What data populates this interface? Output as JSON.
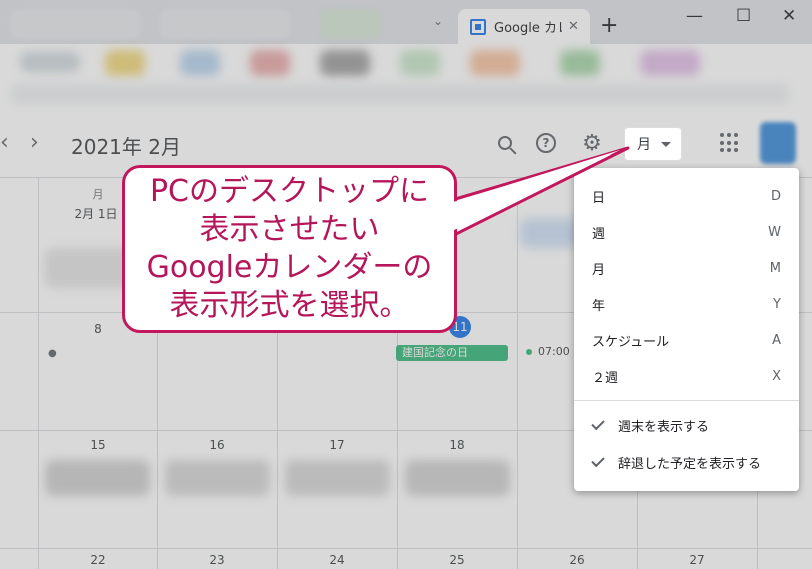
{
  "browser": {
    "tab_title": "Google カレンダー",
    "close_glyph": "✕",
    "new_tab_glyph": "+",
    "tab_dropdown_glyph": "⌄",
    "window_controls": {
      "minimize": "—",
      "maximize": "☐",
      "close": "✕"
    }
  },
  "header": {
    "prev_glyph": "‹",
    "next_glyph": "›",
    "month_title": "2021年 2月",
    "view_selector": "月",
    "icons": [
      "search-icon",
      "help-icon",
      "gear-icon",
      "apps-icon"
    ]
  },
  "grid": {
    "first_col_dow": "月",
    "first_col_date": "2月 1日",
    "week2": [
      "8",
      "11"
    ],
    "week3": [
      "15",
      "16",
      "17",
      "18"
    ],
    "week4": [
      "22",
      "23",
      "24",
      "25",
      "26",
      "27"
    ],
    "holiday_label": "建国記念の日",
    "event_time": "07:00"
  },
  "menu": {
    "items": [
      {
        "label": "日",
        "key": "D"
      },
      {
        "label": "週",
        "key": "W"
      },
      {
        "label": "月",
        "key": "M"
      },
      {
        "label": "年",
        "key": "Y"
      },
      {
        "label": "スケジュール",
        "key": "A"
      },
      {
        "label": "２週",
        "key": "X"
      }
    ],
    "checks": [
      {
        "label": "週末を表示する"
      },
      {
        "label": "辞退した予定を表示する"
      }
    ]
  },
  "callout": {
    "text": "PCのデスクトップに\n表示させたい\nGoogleカレンダーの\n表示形式を選択。"
  },
  "colors": {
    "accent": "#1a73e8",
    "holiday": "#33b679",
    "callout_border": "#c2185b",
    "callout_text": "#b5165a"
  }
}
